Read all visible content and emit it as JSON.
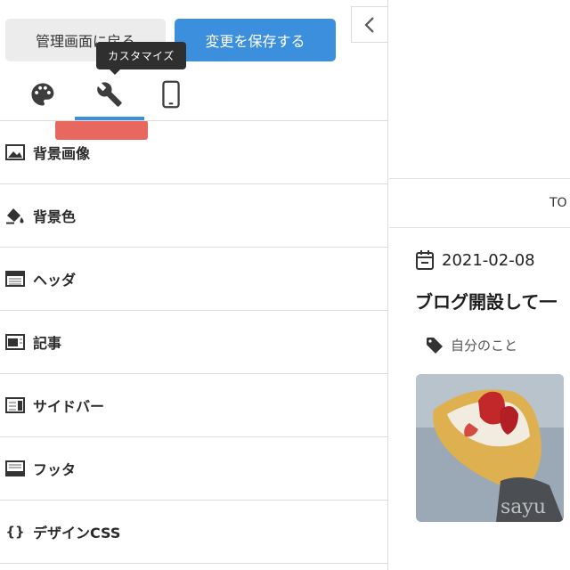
{
  "header": {
    "admin_button_label": "管理画面に戻る",
    "save_button_label": "変更を保存する",
    "tooltip": "カスタマイズ"
  },
  "tabs": [
    {
      "name": "palette-icon"
    },
    {
      "name": "wrench-icon",
      "active": true
    },
    {
      "name": "smartphone-icon"
    }
  ],
  "menu": {
    "items": [
      {
        "label": "背景画像",
        "icon": "image-icon"
      },
      {
        "label": "背景色",
        "icon": "paint-bucket-icon"
      },
      {
        "label": "ヘッダ",
        "icon": "header-layout-icon"
      },
      {
        "label": "記事",
        "icon": "article-layout-icon"
      },
      {
        "label": "サイドバー",
        "icon": "sidebar-layout-icon"
      },
      {
        "label": "フッタ",
        "icon": "footer-layout-icon"
      },
      {
        "label": "デザインCSS",
        "icon": "braces-icon",
        "icon_text": "{}"
      }
    ]
  },
  "preview": {
    "nav_text": "TO",
    "post_date": "2021-02-08",
    "post_title": "ブログ開設して一",
    "tag": "自分のこと",
    "thumbnail_watermark": "sayu"
  },
  "colors": {
    "accent": "#3c8fdc",
    "annotation": "#e8675f",
    "tooltip_bg": "#2f2f2f"
  }
}
